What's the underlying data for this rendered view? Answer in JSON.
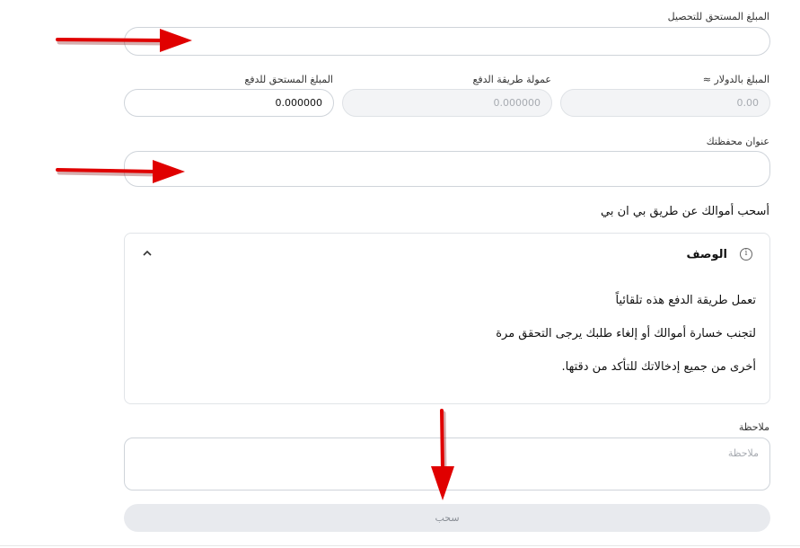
{
  "collection_amount": {
    "label": "المبلغ المستحق للتحصيل",
    "value": ""
  },
  "usd_amount": {
    "label": "المبلغ بالدولار ≈",
    "placeholder": "0.00"
  },
  "payment_fee": {
    "label": "عمولة طريقة الدفع",
    "placeholder": "0.000000"
  },
  "amount_due": {
    "label": "المبلغ المستحق للدفع",
    "value": "0.000000"
  },
  "wallet_address": {
    "label": "عنوان محفظتك",
    "value": ""
  },
  "withdraw_heading": "أسحب أموالك عن طريق بي ان بي",
  "description": {
    "title": "الوصف",
    "icon": "info-icon",
    "lines": [
      "تعمل طريقة الدفع هذه تلقائياً",
      "لتجنب خسارة أموالك أو إلغاء طلبك يرجى التحقق مرة",
      "أخرى من جميع إدخالاتك للتأكد من دقتها."
    ]
  },
  "note": {
    "label": "ملاحظة",
    "placeholder": "ملاحظة"
  },
  "submit_label": "سحب",
  "annotation_color": "#e00000"
}
